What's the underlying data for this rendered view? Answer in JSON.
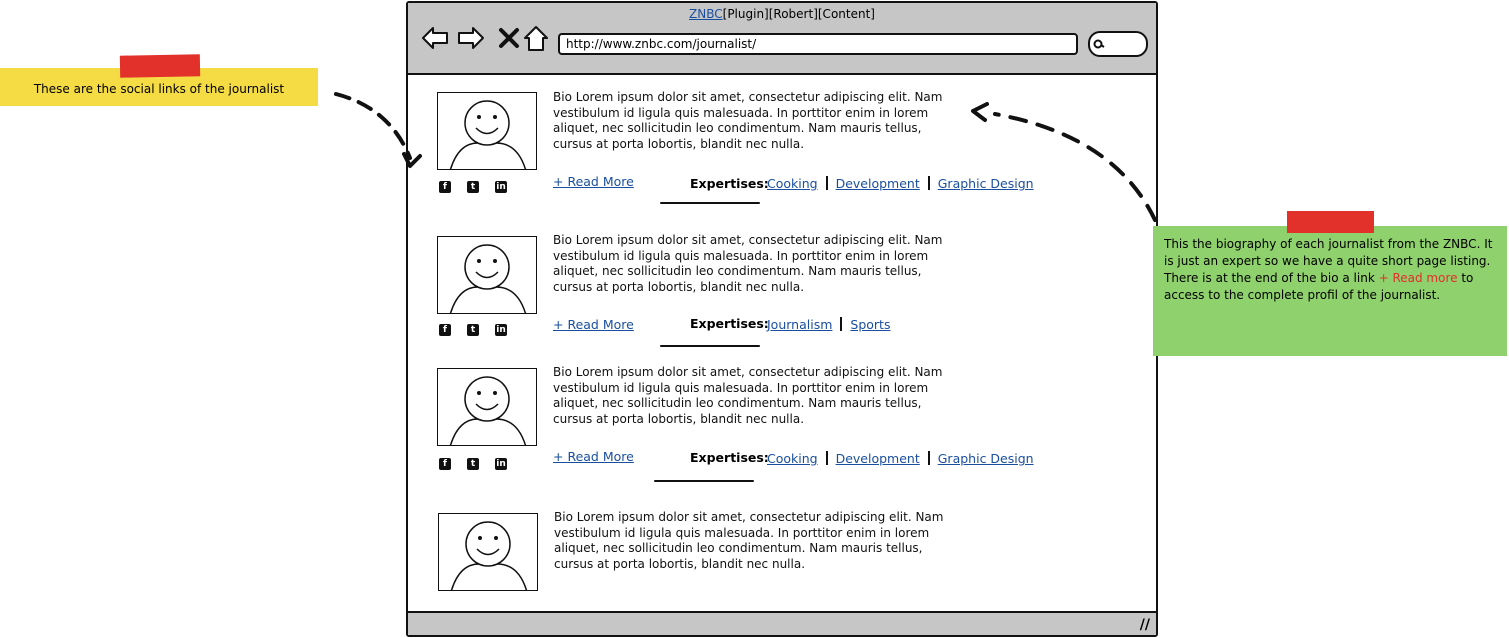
{
  "browser": {
    "title_link": "ZNBC",
    "title_rest": "[Plugin][Robert][Content]",
    "url": "http://www.znbc.com/journalist/"
  },
  "nav_icons": [
    "back-arrow-icon",
    "forward-arrow-icon",
    "close-x-icon",
    "home-icon"
  ],
  "social_icons": [
    "facebook-icon",
    "twitter-icon",
    "linkedin-icon"
  ],
  "entries": [
    {
      "bio": "Bio Lorem ipsum dolor sit amet, consectetur adipiscing elit. Nam vestibulum id ligula quis malesuada. In porttitor enim in lorem aliquet, nec sollicitudin leo condimentum. Nam mauris tellus, cursus at porta lobortis, blandit nec nulla.",
      "read_more": "+ Read More",
      "expertises_label": "Expertises:",
      "expertises": [
        "Cooking",
        "Development",
        "Graphic Design"
      ]
    },
    {
      "bio": "Bio Lorem ipsum dolor sit amet, consectetur adipiscing elit. Nam vestibulum id ligula quis malesuada. In porttitor enim in lorem aliquet, nec sollicitudin leo condimentum. Nam mauris tellus, cursus at porta lobortis, blandit nec nulla.",
      "read_more": "+ Read More",
      "expertises_label": "Expertises:",
      "expertises": [
        "Journalism",
        "Sports"
      ]
    },
    {
      "bio": "Bio Lorem ipsum dolor sit amet, consectetur adipiscing elit. Nam vestibulum id ligula quis malesuada. In porttitor enim in lorem aliquet, nec sollicitudin leo condimentum. Nam mauris tellus, cursus at porta lobortis, blandit nec nulla.",
      "read_more": "+ Read More",
      "expertises_label": "Expertises:",
      "expertises": [
        "Cooking",
        "Development",
        "Graphic Design"
      ]
    },
    {
      "bio": "Bio Lorem ipsum dolor sit amet, consectetur adipiscing elit. Nam vestibulum id ligula quis malesuada. In porttitor enim in lorem aliquet, nec sollicitudin leo condimentum. Nam mauris tellus, cursus at porta lobortis, blandit nec nulla."
    }
  ],
  "notes": {
    "social": "These are the social links of the journalist",
    "bio_before": "This the biography of each journalist from the ZNBC. It is just an expert so we have a quite short page listing. There is at the end of the bio a link ",
    "bio_highlight": "+ Read more",
    "bio_after": " to access to the complete profil of the journalist."
  },
  "colors": {
    "link": "#1a4fa0",
    "chrome": "#c6c6c6",
    "note_yellow": "#f5dc45",
    "note_green": "#8fd16c",
    "tape_red": "#e2302a"
  }
}
